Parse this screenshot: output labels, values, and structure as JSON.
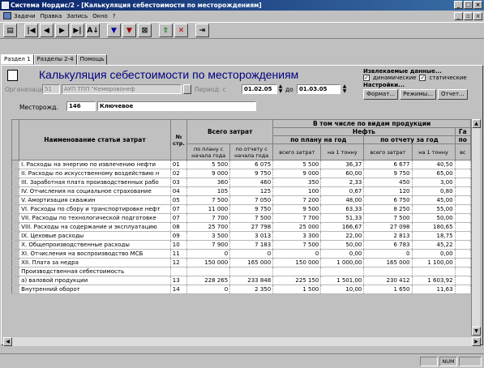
{
  "window": {
    "title": "Система Нордис/2 - [Калькуляция себестоимости по месторождениям]"
  },
  "menu": [
    "Задачи",
    "Правка",
    "Запись",
    "Окно",
    "?"
  ],
  "tabs": [
    "Раздел 1",
    "Разделы 2-4",
    "Помощь"
  ],
  "header": {
    "title": "Калькуляция себестоимости по месторождениям",
    "org_label": "Организация",
    "org_code": "51",
    "org_name": "АУП ТПП \"Кемеровонеф",
    "period_label": "Период: с",
    "date_from": "01.02.05",
    "to_label": "до",
    "date_to": "01.03.05",
    "field_label": "Месторожд.",
    "field_code": "146",
    "field_name": "Ключевое"
  },
  "options": {
    "title": "Извлекаемые данные...",
    "dynamic_label": "динамические",
    "static_label": "статические",
    "settings_label": "Настройки...",
    "format_button": "Формат...",
    "modes_button": "Режимы...",
    "report_button": "Отчет..."
  },
  "grid": {
    "col_name": "Наименование статьи затрат",
    "col_num": "№ стр.",
    "col_total": "Всего затрат",
    "col_by_type": "В том числе по видам продукции",
    "col_oil": "Нефть",
    "col_gas": "Га",
    "col_plan_year": "по плану на год",
    "col_report_year": "по отчету за год",
    "col_po": "по",
    "sub_plan_start": "по плану с начала года",
    "sub_report_start": "по отчету с начала года",
    "sub_total": "всего затрат",
    "sub_per_ton": "на 1 тонну",
    "sub_total2": "всего затрат",
    "sub_per_ton2": "на 1 тонну",
    "sub_vs": "вс",
    "rows": [
      {
        "name": "I. Расходы на энергию по извлечению нефти",
        "num": "01",
        "a": "5 500",
        "b": "6 075",
        "c": "5 500",
        "d": "36,37",
        "e": "6 677",
        "f": "40,50"
      },
      {
        "name": "II. Расходы по искусственному воздействию н",
        "num": "02",
        "a": "9 000",
        "b": "9 750",
        "c": "9 000",
        "d": "60,00",
        "e": "9 750",
        "f": "65,00"
      },
      {
        "name": "III. Заработная плата производственных рабо",
        "num": "03",
        "a": "360",
        "b": "460",
        "c": "350",
        "d": "2,33",
        "e": "450",
        "f": "3,00"
      },
      {
        "name": "IV. Отчисления на социальное страхование",
        "num": "04",
        "a": "105",
        "b": "125",
        "c": "100",
        "d": "0,67",
        "e": "120",
        "f": "0,80"
      },
      {
        "name": "V. Амортизация скважин",
        "num": "05",
        "a": "7 500",
        "b": "7 050",
        "c": "7 200",
        "d": "48,00",
        "e": "6 750",
        "f": "45,00"
      },
      {
        "name": "VI. Расходы по сбору и транспортировке нефт",
        "num": "07",
        "a": "11 000",
        "b": "9 750",
        "c": "9 500",
        "d": "63,33",
        "e": "8 250",
        "f": "55,00"
      },
      {
        "name": "VII. Расходы по технологической подготовке",
        "num": "07",
        "a": "7 700",
        "b": "7 500",
        "c": "7 700",
        "d": "51,33",
        "e": "7 500",
        "f": "50,00"
      },
      {
        "name": "VIII. Расходы на содержание и эксплуатацию",
        "num": "08",
        "a": "25 700",
        "b": "27 798",
        "c": "25 000",
        "d": "166,67",
        "e": "27 098",
        "f": "180,65"
      },
      {
        "name": "IX. Цеховые расходы",
        "num": "09",
        "a": "3 500",
        "b": "3 013",
        "c": "3 300",
        "d": "22,00",
        "e": "2 813",
        "f": "18,75"
      },
      {
        "name": "X. Общепроизводственные расходы",
        "num": "10",
        "a": "7 900",
        "b": "7 183",
        "c": "7 500",
        "d": "50,00",
        "e": "6 783",
        "f": "45,22"
      },
      {
        "name": "XI. Отчисления на воспроизводство МСБ",
        "num": "11",
        "a": "0",
        "b": "0",
        "c": "0",
        "d": "0,00",
        "e": "0",
        "f": "0,00"
      },
      {
        "name": "XII. Плата за недра",
        "num": "12",
        "a": "150 000",
        "b": "165 000",
        "c": "150 000",
        "d": "1 000,00",
        "e": "165 000",
        "f": "1 100,00"
      },
      {
        "name": "Производственная себестоимость",
        "num": "",
        "a": "",
        "b": "",
        "c": "",
        "d": "",
        "e": "",
        "f": ""
      },
      {
        "name": "  а) валовой продукции",
        "num": "13",
        "a": "228 265",
        "b": "233 848",
        "c": "225 150",
        "d": "1 501,00",
        "e": "230 412",
        "f": "1 603,92"
      },
      {
        "name": "  Внутренний оборот",
        "num": "14",
        "a": "0",
        "b": "2 350",
        "c": "1 500",
        "d": "10,00",
        "e": "1 650",
        "f": "11,63"
      }
    ]
  },
  "status": {
    "num": "NUM"
  }
}
